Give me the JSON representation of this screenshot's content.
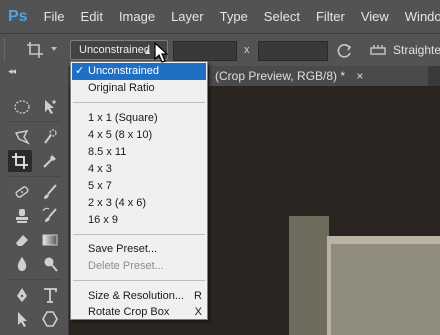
{
  "app": {
    "logo": "Ps"
  },
  "menubar": [
    "File",
    "Edit",
    "Image",
    "Layer",
    "Type",
    "Select",
    "Filter",
    "View",
    "Window"
  ],
  "options": {
    "ratio_value": "Unconstrained",
    "width_value": "",
    "height_value": "",
    "x_label": "x",
    "straighten_label": "Straighten"
  },
  "toolbar": {
    "collapse_glyph": "◂◂"
  },
  "document": {
    "tab_title": "(Crop Preview, RGB/8) *",
    "close_glyph": "×"
  },
  "dropdown": {
    "items": [
      {
        "label": "Unconstrained",
        "checked": true,
        "selected": true
      },
      {
        "label": "Original Ratio"
      },
      {
        "label": "1 x 1 (Square)"
      },
      {
        "label": "4 x 5 (8 x 10)"
      },
      {
        "label": "8.5 x 11"
      },
      {
        "label": "4 x 3"
      },
      {
        "label": "5 x 7"
      },
      {
        "label": "2 x 3 (4 x 6)"
      },
      {
        "label": "16 x 9"
      },
      {
        "label": "Save Preset..."
      },
      {
        "label": "Delete Preset...",
        "disabled": true
      },
      {
        "label": "Size & Resolution...",
        "shortcut": "R"
      },
      {
        "label": "Rotate Crop Box",
        "shortcut": "X"
      }
    ],
    "check_glyph": "✓"
  },
  "colors": {
    "selection": "#1f6fc5",
    "ps_blue": "#49a7e8",
    "ui_gray": "#535353"
  }
}
